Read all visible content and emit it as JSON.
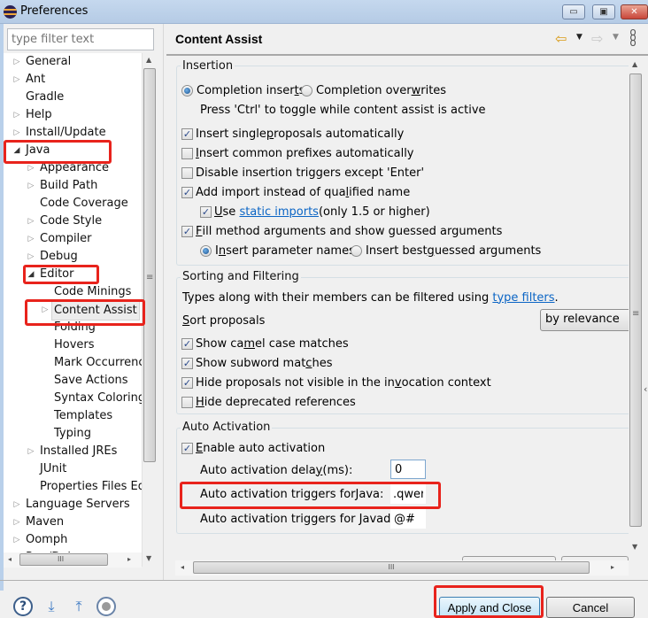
{
  "window": {
    "title": "Preferences",
    "icon": "eclipse-icon",
    "controls": {
      "minimize": "▭",
      "maximize": "▣",
      "close": "✕"
    }
  },
  "sidebar": {
    "filter_placeholder": "type filter text",
    "tree": [
      {
        "label": "General",
        "level": 0,
        "twisty": "collapsed"
      },
      {
        "label": "Ant",
        "level": 0,
        "twisty": "collapsed"
      },
      {
        "label": "Gradle",
        "level": 0,
        "twisty": "none"
      },
      {
        "label": "Help",
        "level": 0,
        "twisty": "collapsed"
      },
      {
        "label": "Install/Update",
        "level": 0,
        "twisty": "collapsed"
      },
      {
        "label": "Java",
        "level": 0,
        "twisty": "expanded"
      },
      {
        "label": "Appearance",
        "level": 1,
        "twisty": "collapsed"
      },
      {
        "label": "Build Path",
        "level": 1,
        "twisty": "collapsed"
      },
      {
        "label": "Code Coverage",
        "level": 1,
        "twisty": "none"
      },
      {
        "label": "Code Style",
        "level": 1,
        "twisty": "collapsed"
      },
      {
        "label": "Compiler",
        "level": 1,
        "twisty": "collapsed"
      },
      {
        "label": "Debug",
        "level": 1,
        "twisty": "collapsed"
      },
      {
        "label": "Editor",
        "level": 1,
        "twisty": "expanded"
      },
      {
        "label": "Code Minings",
        "level": 2,
        "twisty": "none"
      },
      {
        "label": "Content Assist",
        "level": 2,
        "twisty": "collapsed",
        "selected": true
      },
      {
        "label": "Folding",
        "level": 2,
        "twisty": "none"
      },
      {
        "label": "Hovers",
        "level": 2,
        "twisty": "none"
      },
      {
        "label": "Mark Occurrences",
        "level": 2,
        "twisty": "none"
      },
      {
        "label": "Save Actions",
        "level": 2,
        "twisty": "none"
      },
      {
        "label": "Syntax Coloring",
        "level": 2,
        "twisty": "none"
      },
      {
        "label": "Templates",
        "level": 2,
        "twisty": "none"
      },
      {
        "label": "Typing",
        "level": 2,
        "twisty": "none"
      },
      {
        "label": "Installed JREs",
        "level": 1,
        "twisty": "collapsed"
      },
      {
        "label": "JUnit",
        "level": 1,
        "twisty": "none"
      },
      {
        "label": "Properties Files Editor",
        "level": 1,
        "twisty": "none"
      },
      {
        "label": "Language Servers",
        "level": 0,
        "twisty": "collapsed"
      },
      {
        "label": "Maven",
        "level": 0,
        "twisty": "collapsed"
      },
      {
        "label": "Oomph",
        "level": 0,
        "twisty": "collapsed"
      },
      {
        "label": "Run/Debug",
        "level": 0,
        "twisty": "collapsed"
      }
    ]
  },
  "header": {
    "title": "Content Assist",
    "back_icon": "⇦",
    "forward_icon": "⇨",
    "dropdown_icon": "▼",
    "menu_icon": "⋮"
  },
  "insertion": {
    "title": "Insertion",
    "completion_inserts": {
      "pre": "Completion inser",
      "mn": "t",
      "post": "s",
      "checked": true
    },
    "completion_overwrites": {
      "pre": "Completion over",
      "mn": "w",
      "post": "rites",
      "checked": false
    },
    "toggle_hint": "Press 'Ctrl' to toggle while content assist is active",
    "insert_single": {
      "pre": "Insert single ",
      "mn": "p",
      "post": "roposals automatically",
      "checked": true
    },
    "insert_common": {
      "pre": "",
      "mn": "I",
      "post": "nsert common prefixes automatically",
      "checked": false
    },
    "disable_triggers": {
      "pre": "Disable insertion triggers except 'Enter'",
      "mn": "",
      "post": "",
      "checked": false
    },
    "add_import": {
      "pre": "Add import instead of qua",
      "mn": "l",
      "post": "ified name",
      "checked": true
    },
    "use_static": {
      "pre": "",
      "mn": "U",
      "post": "se ",
      "link": "static imports",
      "suffix": " (only 1.5 or higher)",
      "checked": true
    },
    "fill_args": {
      "pre": "",
      "mn": "F",
      "post": "ill method arguments and show guessed arguments",
      "checked": true
    },
    "insert_param_names": {
      "pre": "I",
      "mn": "n",
      "post": "sert parameter names",
      "checked": true
    },
    "insert_best_guessed": {
      "pre": "Insert best ",
      "mn": "g",
      "post": "uessed arguments",
      "checked": false
    }
  },
  "sorting": {
    "title": "Sorting and Filtering",
    "types_text": "Types along with their members can be filtered using ",
    "types_link": "type filters",
    "types_suffix": ".",
    "sort_label": {
      "pre": "",
      "mn": "S",
      "post": "ort proposals"
    },
    "sort_value": "by relevance",
    "camel_case": {
      "pre": "Show ca",
      "mn": "m",
      "post": "el case matches",
      "checked": true
    },
    "subword": {
      "pre": "Show subword mat",
      "mn": "c",
      "post": "hes",
      "checked": true
    },
    "hide_not_visible": {
      "pre": "Hide proposals not visible in the in",
      "mn": "v",
      "post": "ocation context",
      "checked": true
    },
    "hide_deprecated": {
      "pre": "",
      "mn": "H",
      "post": "ide deprecated references",
      "checked": false
    }
  },
  "auto_activation": {
    "title": "Auto Activation",
    "enable": {
      "pre": "",
      "mn": "E",
      "post": "nable auto activation",
      "checked": true
    },
    "delay_label": {
      "pre": "Auto activation dela",
      "mn": "y",
      "post": " (ms):"
    },
    "delay_value": "0",
    "java_label": {
      "pre": "Auto activation triggers for ",
      "mn": "J",
      "post": "ava:"
    },
    "java_value": ".qwer",
    "javadoc_label": {
      "pre": "Auto activation triggers for Javad",
      "mn": "o",
      "post": "c:"
    },
    "javadoc_value": "@#"
  },
  "footer": {
    "help_icon": "?",
    "import_icon": "⤓",
    "export_icon": "⤒",
    "apply_close": "Apply and Close",
    "cancel": "Cancel"
  },
  "scroll": {
    "grip": "≡",
    "hgrip": "III",
    "up": "▲",
    "down": "▼",
    "left": "◂",
    "right": "▸",
    "collapse": "‹"
  }
}
